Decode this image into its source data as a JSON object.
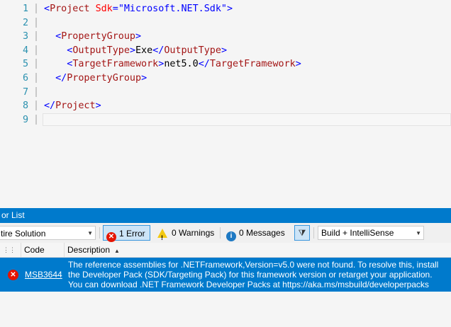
{
  "editor": {
    "lines": [
      {
        "n": "1",
        "parts": [
          [
            "br",
            "<"
          ],
          [
            "tag",
            "Project"
          ],
          [
            "txt",
            " "
          ],
          [
            "attr",
            "Sdk"
          ],
          [
            "br",
            "="
          ],
          [
            "val",
            "\"Microsoft.NET.Sdk\""
          ],
          [
            "br",
            ">"
          ]
        ]
      },
      {
        "n": "2",
        "parts": []
      },
      {
        "n": "3",
        "parts": [
          [
            "txt",
            "  "
          ],
          [
            "br",
            "<"
          ],
          [
            "tag",
            "PropertyGroup"
          ],
          [
            "br",
            ">"
          ]
        ]
      },
      {
        "n": "4",
        "parts": [
          [
            "txt",
            "    "
          ],
          [
            "br",
            "<"
          ],
          [
            "tag",
            "OutputType"
          ],
          [
            "br",
            ">"
          ],
          [
            "txt",
            "Exe"
          ],
          [
            "br",
            "</"
          ],
          [
            "tag",
            "OutputType"
          ],
          [
            "br",
            ">"
          ]
        ]
      },
      {
        "n": "5",
        "parts": [
          [
            "txt",
            "    "
          ],
          [
            "br",
            "<"
          ],
          [
            "tag",
            "TargetFramework"
          ],
          [
            "br",
            ">"
          ],
          [
            "txt",
            "net5.0"
          ],
          [
            "br",
            "</"
          ],
          [
            "tag",
            "TargetFramework"
          ],
          [
            "br",
            ">"
          ]
        ]
      },
      {
        "n": "6",
        "parts": [
          [
            "txt",
            "  "
          ],
          [
            "br",
            "</"
          ],
          [
            "tag",
            "PropertyGroup"
          ],
          [
            "br",
            ">"
          ]
        ]
      },
      {
        "n": "7",
        "parts": []
      },
      {
        "n": "8",
        "parts": [
          [
            "br",
            "</"
          ],
          [
            "tag",
            "Project"
          ],
          [
            "br",
            ">"
          ]
        ]
      },
      {
        "n": "9",
        "parts": []
      }
    ]
  },
  "panel": {
    "title": "or List",
    "scope": "tire Solution",
    "errors_label": "1 Error",
    "warnings_label": "0 Warnings",
    "messages_label": "0 Messages",
    "build_filter": "Build + IntelliSense",
    "columns": {
      "code": "Code",
      "description": "Description"
    },
    "rows": [
      {
        "code": "MSB3644",
        "description": "The reference assemblies for .NETFramework,Version=v5.0 were not found. To resolve this, install the Developer Pack (SDK/Targeting Pack) for this framework version or retarget your application. You can download .NET Framework Developer Packs at https://aka.ms/msbuild/developerpacks"
      }
    ]
  },
  "colors": {
    "accent": "#007acc",
    "error": "#e51400",
    "warning": "#f2c811",
    "info": "#1e79c3"
  },
  "icons": {
    "error": "error-icon",
    "warning": "warning-icon",
    "message": "info-icon",
    "filter": "filter-icon"
  }
}
